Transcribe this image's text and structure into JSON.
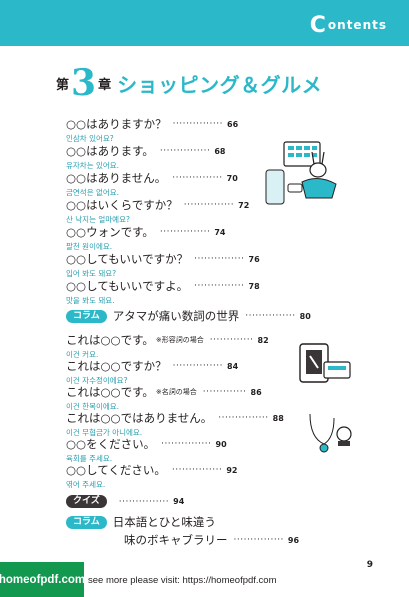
{
  "header": {
    "title_initial": "C",
    "title_rest": "ontents"
  },
  "chapter": {
    "label_pre": "第",
    "number": "3",
    "label_post": "章",
    "title": "ショッピング＆グルメ"
  },
  "entries": [
    {
      "jp": "○○はありますか？",
      "page": "66",
      "ko": "인삼차 있어요?"
    },
    {
      "jp": "○○はあります。",
      "page": "68",
      "ko": "유자차는 있어요."
    },
    {
      "jp": "○○はありません。",
      "page": "70",
      "ko": "금연석은 없어요."
    },
    {
      "jp": "○○はいくらですか？",
      "page": "72",
      "ko": "산 낙지는 얼마예요?"
    },
    {
      "jp": "○○ウォンです。",
      "page": "74",
      "ko": "팔천 원이에요."
    },
    {
      "jp": "○○してもいいですか？",
      "page": "76",
      "ko": "입어 봐도 돼요?"
    },
    {
      "jp": "○○してもいいですよ。",
      "page": "78",
      "ko": "맛을 봐도 돼요."
    }
  ],
  "column1": {
    "tag": "コラム",
    "title": "アタマが痛い数詞の世界",
    "page": "80"
  },
  "entries2": [
    {
      "jp": "これは○○です。",
      "note": "※形容詞の場合",
      "page": "82",
      "ko": "이건 커요."
    },
    {
      "jp": "これは○○ですか？",
      "note": "",
      "page": "84",
      "ko": "이건 자수정이에요?"
    },
    {
      "jp": "これは○○です。",
      "note": "※名詞の場合",
      "page": "86",
      "ko": "이건 한복이에요."
    },
    {
      "jp": "これは○○ではありません。",
      "note": "",
      "page": "88",
      "ko": "이건 무협금가 아니에요."
    },
    {
      "jp": "○○をください。",
      "note": "",
      "page": "90",
      "ko": "육회를 주세요."
    },
    {
      "jp": "○○してください。",
      "note": "",
      "page": "92",
      "ko": "엮어 주세요."
    }
  ],
  "quiz": {
    "tag": "クイズ",
    "page": "94"
  },
  "column2": {
    "tag": "コラム",
    "title_line1": "日本語とひと味違う",
    "title_line2": "味のボキャブラリー",
    "page": "96"
  },
  "footer": {
    "page_number": "9",
    "logo_text": "homeofpdf.com",
    "visit_text": "see more please visit: https://homeofpdf.com"
  },
  "colors": {
    "accent": "#2bb8c8",
    "korean_text": "#2a9fb0",
    "dark_tag": "#3a3536",
    "logo_bg": "#13984f"
  }
}
